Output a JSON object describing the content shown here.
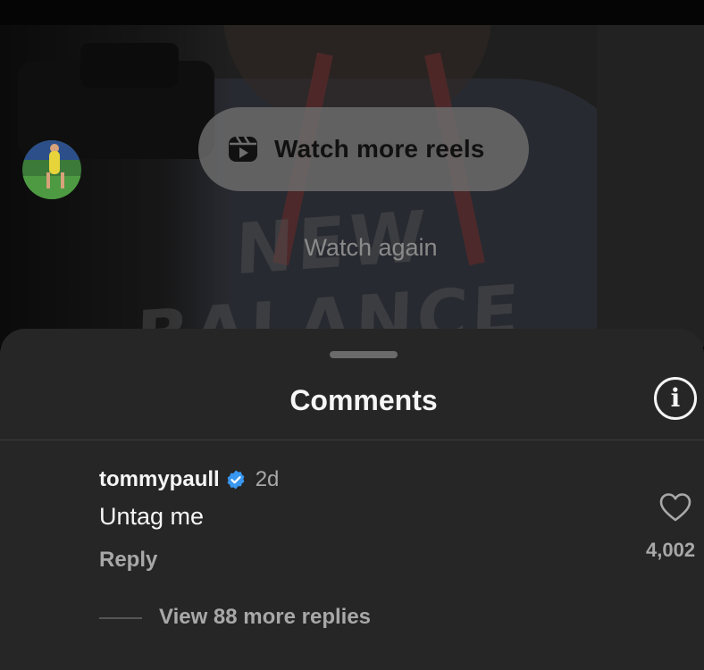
{
  "player": {
    "background_brand": "NEW BALANCE",
    "watch_more_label": "Watch more reels",
    "watch_again_label": "Watch again",
    "reels_icon": "reels-icon"
  },
  "comments_sheet": {
    "title": "Comments",
    "info_icon": "info-icon",
    "comments": [
      {
        "username": "tommypaull",
        "verified": true,
        "time": "2d",
        "text": "Untag me",
        "reply_label": "Reply",
        "like_count": "4,002",
        "view_replies_label": "View 88 more replies"
      }
    ]
  },
  "colors": {
    "sheet_background": "#262626",
    "verified_badge": "#3897f0",
    "secondary_text": "#a8a8a8"
  }
}
